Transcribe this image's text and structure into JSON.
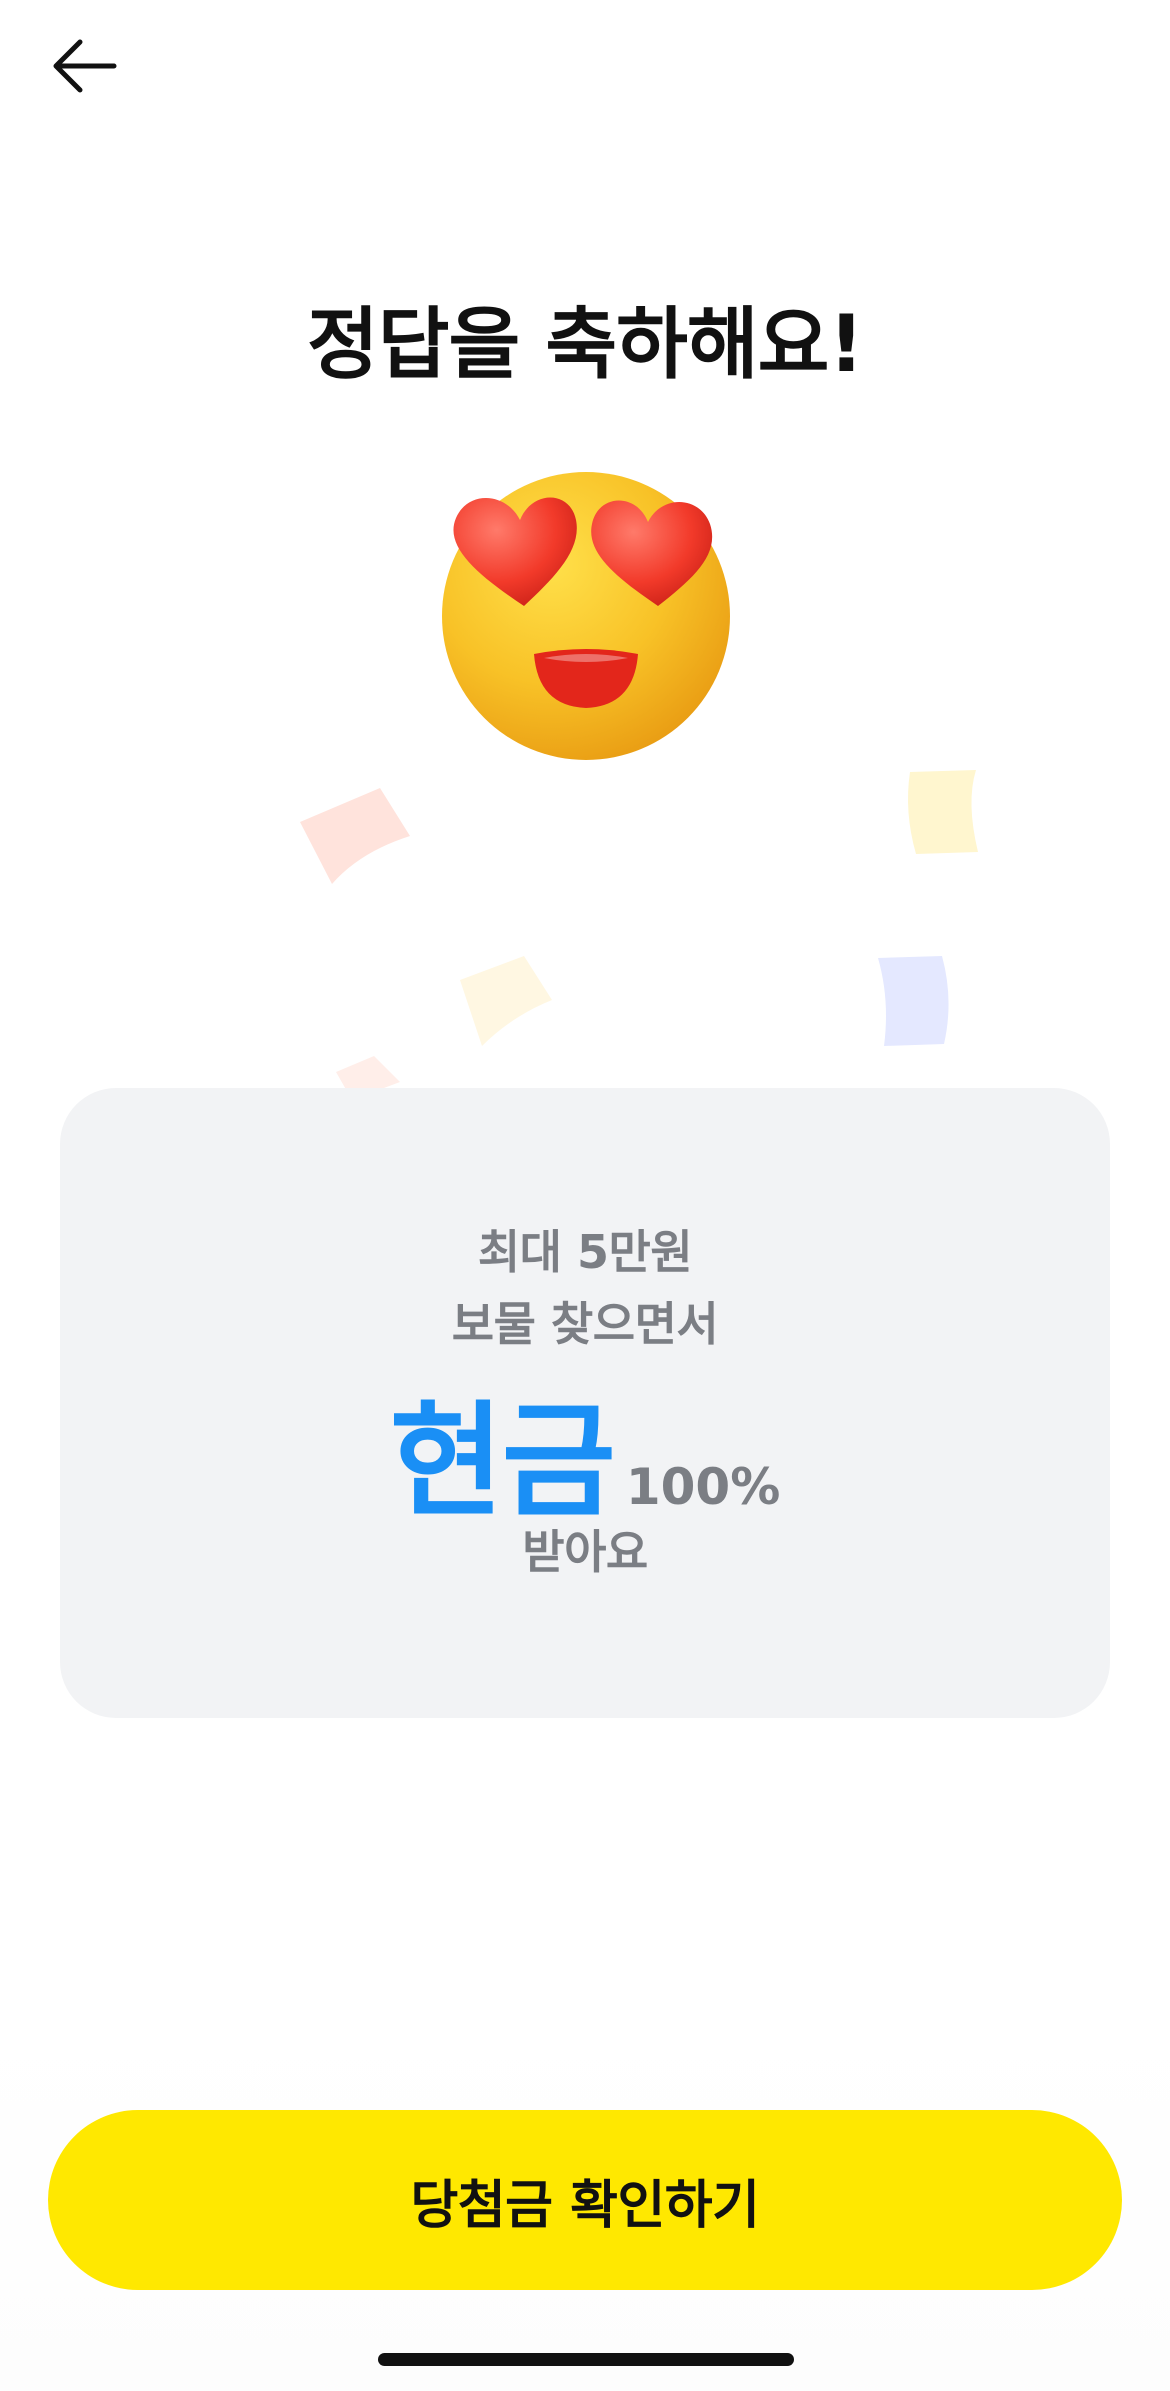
{
  "header": {
    "back_icon": "arrow-left-icon"
  },
  "title": "정답을 축하해요!",
  "emoji_icon": "heart-eyes-emoji",
  "card": {
    "line_1": "최대 5만원",
    "line_2": "보물 찾으면서",
    "highlight": "현금",
    "highlight_suffix": "100%",
    "line_4": "받아요"
  },
  "cta": {
    "label": "당첨금 확인하기"
  },
  "colors": {
    "accent_blue": "#1a8ff5",
    "cta_yellow": "#ffe800",
    "card_bg": "#f2f3f5",
    "muted_text": "#7b7e84"
  }
}
